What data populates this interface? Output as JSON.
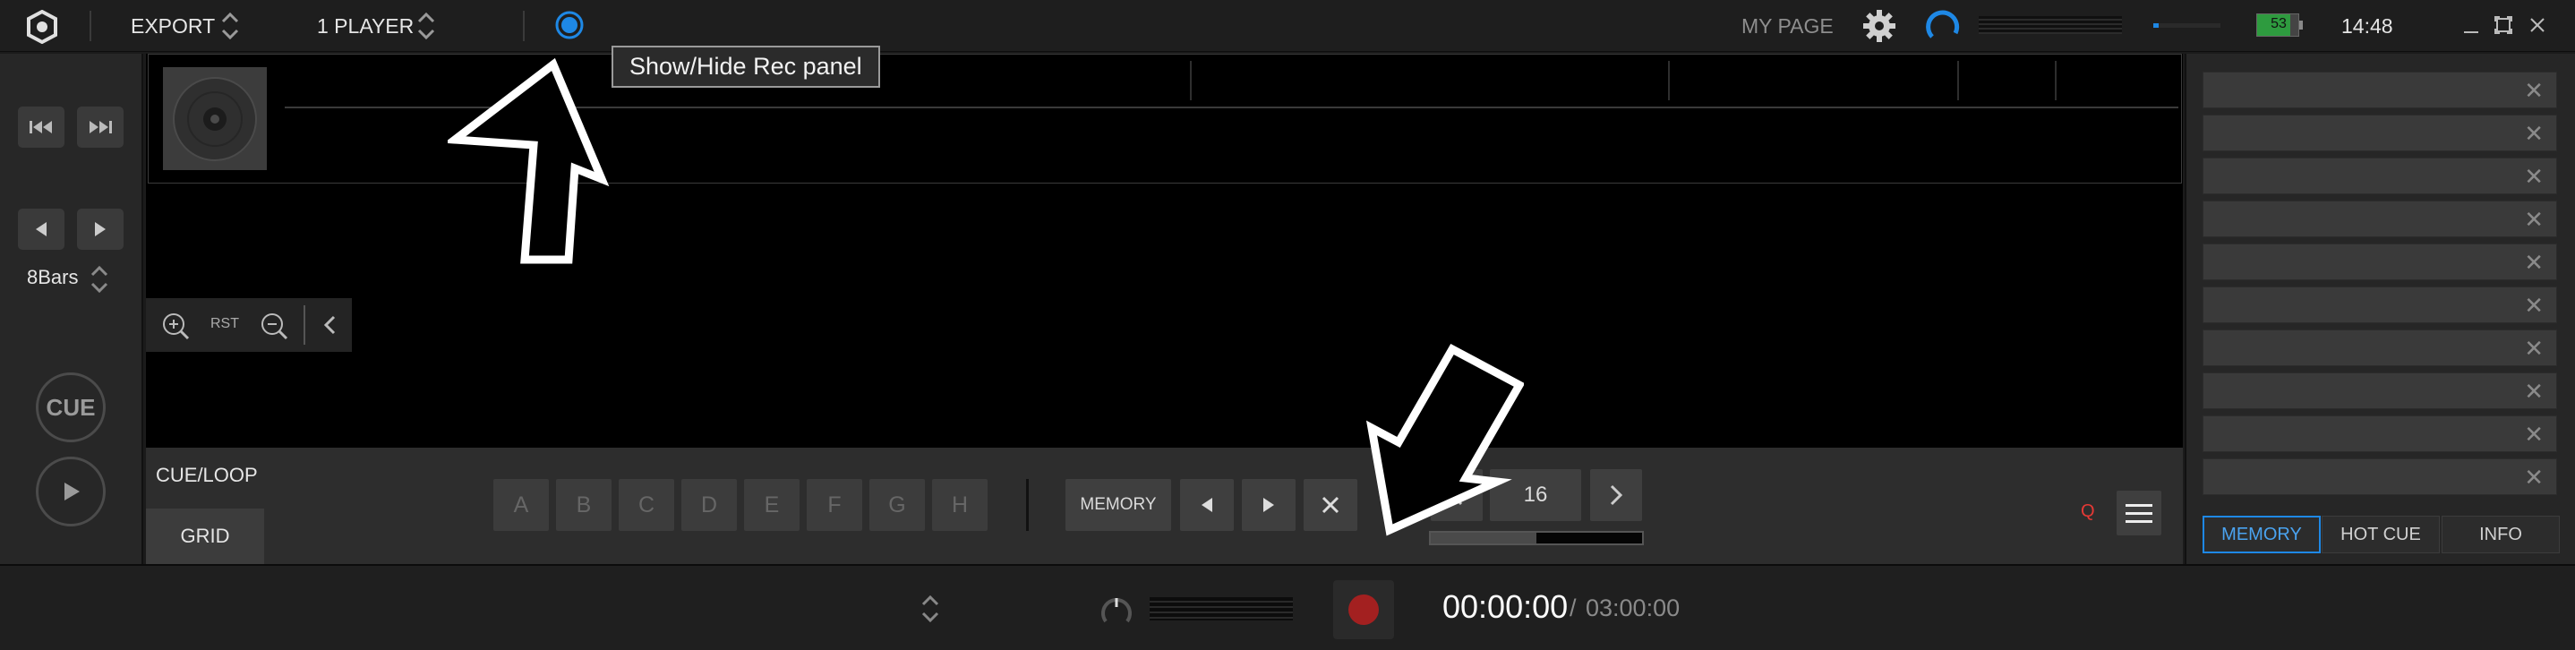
{
  "header": {
    "export_label": "EXPORT",
    "player_label": "1 PLAYER",
    "tooltip": "Show/Hide Rec panel",
    "mypage_label": "MY PAGE",
    "battery_level": "53",
    "battery_fill_percent": 80,
    "clock": "14:48"
  },
  "left": {
    "beat_label": "8Bars",
    "cue_label": "CUE"
  },
  "zoom": {
    "reset_label": "RST"
  },
  "cueloop": {
    "cue_loop_label": "CUE/LOOP",
    "grid_label": "GRID",
    "hotcues": [
      "A",
      "B",
      "C",
      "D",
      "E",
      "F",
      "G",
      "H"
    ],
    "memory_label": "MEMORY",
    "loop_beats": "16",
    "q_label": "Q"
  },
  "rightpanel": {
    "tabs": [
      "MEMORY",
      "HOT CUE",
      "INFO"
    ],
    "active_tab": "MEMORY"
  },
  "recording": {
    "elapsed": "00:00:00",
    "separator": "/",
    "total": "03:00:00"
  },
  "colors": {
    "accent": "#1e88e5",
    "q_red": "#e53935",
    "battery_green": "#2e9b3f",
    "rec_red": "#a32020"
  }
}
